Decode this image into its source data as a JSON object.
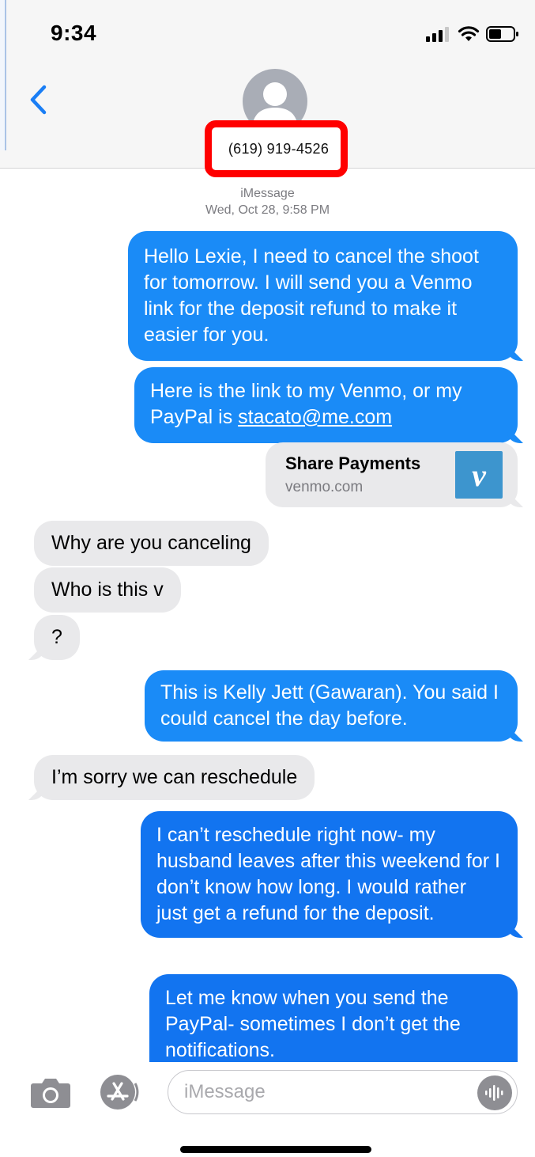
{
  "status_bar": {
    "time": "9:34"
  },
  "header": {
    "contact_number": "(619) 919-4526"
  },
  "thread": {
    "service": "iMessage",
    "timestamp": "Wed, Oct 28, 9:58 PM"
  },
  "messages": [
    {
      "direction": "outgoing",
      "text": "Hello Lexie, I need to cancel the shoot for tomorrow. I will send you a Venmo link for the deposit refund to make it easier for you."
    },
    {
      "direction": "outgoing",
      "text_before_link": "Here is the link to my Venmo, or my PayPal is ",
      "link": "stacato@me.com"
    },
    {
      "direction": "incoming",
      "text": "Why are you canceling"
    },
    {
      "direction": "incoming",
      "text": "Who is this v"
    },
    {
      "direction": "incoming",
      "text": "?"
    },
    {
      "direction": "outgoing",
      "text": "This is Kelly Jett (Gawaran). You said I could cancel the day before."
    },
    {
      "direction": "incoming",
      "text": "I’m sorry we can reschedule"
    },
    {
      "direction": "outgoing",
      "text": "I can’t reschedule right now- my husband leaves after this weekend for I don’t know how long. I would rather just get a refund for the deposit."
    },
    {
      "direction": "outgoing",
      "text": "Let me know when you send the PayPal- sometimes I don’t get the notifications."
    }
  ],
  "link_preview": {
    "title": "Share Payments",
    "domain": "venmo.com",
    "logo_letter": "v",
    "logo_color": "#3d95ce"
  },
  "input_bar": {
    "placeholder": "iMessage",
    "camera_icon": "camera-icon",
    "apps_icon": "app-store-icon",
    "audio_icon": "audio-waveform-icon"
  },
  "colors": {
    "outgoing_bubble": "#1a8bf7",
    "incoming_bubble": "#e9e9eb",
    "highlight_box": "#ff0000",
    "ios_blue": "#1a7ef5"
  }
}
